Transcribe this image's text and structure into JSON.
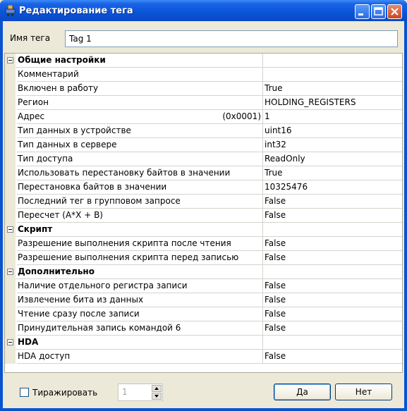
{
  "window": {
    "title": "Редактирование тега"
  },
  "tag_name": {
    "label": "Имя тега",
    "value": "Tag 1"
  },
  "rows": [
    {
      "type": "category",
      "name": "Общие настройки"
    },
    {
      "type": "property",
      "name": "Комментарий",
      "value": ""
    },
    {
      "type": "property",
      "name": "Включен в работу",
      "value": "True"
    },
    {
      "type": "property",
      "name": "Регион",
      "value": "HOLDING_REGISTERS"
    },
    {
      "type": "property",
      "name": "Адрес",
      "extra": "(0x0001)",
      "value": "1"
    },
    {
      "type": "property",
      "name": "Тип данных в устройстве",
      "value": "uint16"
    },
    {
      "type": "property",
      "name": "Тип данных в сервере",
      "value": "int32"
    },
    {
      "type": "property",
      "name": "Тип доступа",
      "value": "ReadOnly"
    },
    {
      "type": "property",
      "name": "Использовать перестановку байтов в значении",
      "value": "True"
    },
    {
      "type": "property",
      "name": "Перестановка байтов в значении",
      "value": "10325476"
    },
    {
      "type": "property",
      "name": "Последний тег в групповом запросе",
      "value": "False"
    },
    {
      "type": "property",
      "name": "Пересчет (A*X + B)",
      "value": "False"
    },
    {
      "type": "category",
      "name": "Скрипт"
    },
    {
      "type": "property",
      "name": "Разрешение выполнения скрипта после чтения",
      "value": "False"
    },
    {
      "type": "property",
      "name": "Разрешение выполнения скрипта перед записью",
      "value": "False"
    },
    {
      "type": "category",
      "name": "Дополнительно"
    },
    {
      "type": "property",
      "name": "Наличие отдельного регистра записи",
      "value": "False"
    },
    {
      "type": "property",
      "name": "Извлечение бита из данных",
      "value": "False"
    },
    {
      "type": "property",
      "name": "Чтение сразу после записи",
      "value": "False"
    },
    {
      "type": "property",
      "name": "Принудительная запись командой 6",
      "value": "False"
    },
    {
      "type": "category",
      "name": "HDA"
    },
    {
      "type": "property",
      "name": "HDA доступ",
      "value": "False"
    }
  ],
  "replicate": {
    "label": "Тиражировать",
    "checked": false,
    "count": "1"
  },
  "buttons": {
    "ok": "Да",
    "cancel": "Нет"
  }
}
